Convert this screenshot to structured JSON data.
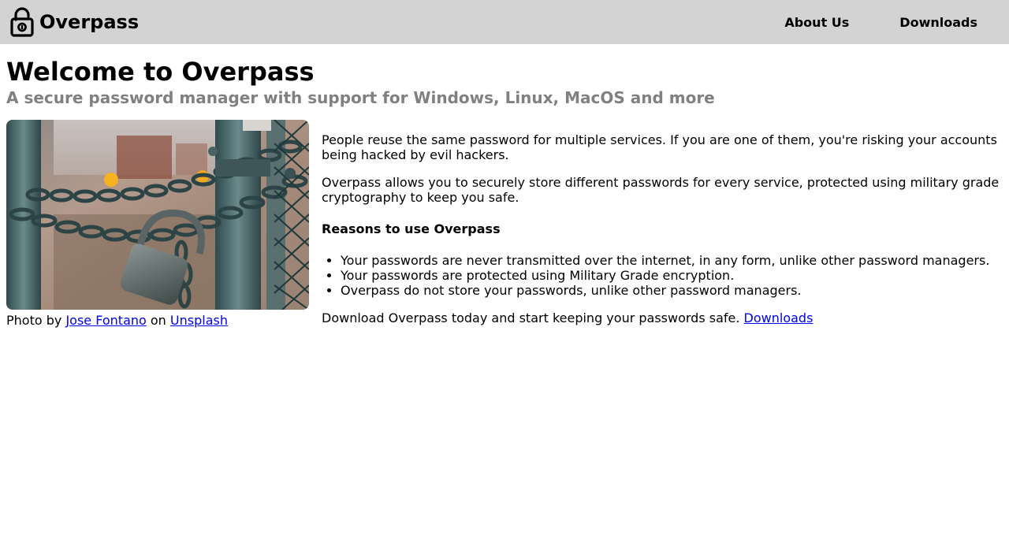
{
  "header": {
    "brand": "Overpass",
    "icon": "padlock-icon",
    "nav": [
      {
        "label": "About Us"
      },
      {
        "label": "Downloads"
      }
    ]
  },
  "main": {
    "title": "Welcome to Overpass",
    "subtitle": "A secure password manager with support for Windows, Linux, MacOS and more",
    "photo": {
      "subject": "chained padlock on rusty gate",
      "credit_prefix": "Photo by",
      "credit_author": "Jose Fontano",
      "credit_middle": "on",
      "credit_site": "Unsplash"
    },
    "paragraph1": "People reuse the same password for multiple services. If you are one of them, you're risking your accounts being hacked by evil hackers.",
    "paragraph2": "Overpass allows you to securely store different passwords for every service, protected using military grade cryptography to keep you safe.",
    "reasons_title": "Reasons to use Overpass",
    "reasons": [
      "Your passwords are never transmitted over the internet, in any form, unlike other password managers.",
      "Your passwords are protected using Military Grade encryption.",
      "Overpass do not store your passwords, unlike other password managers."
    ],
    "download_text": "Download Overpass today and start keeping your passwords safe.",
    "download_link": "Downloads"
  },
  "colors": {
    "header_bg": "#d3d3d3",
    "subtitle": "#808080",
    "link": "#0000ee"
  }
}
